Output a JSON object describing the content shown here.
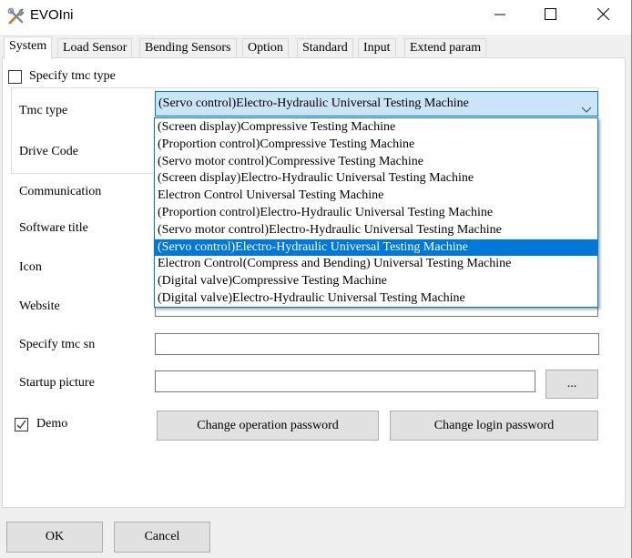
{
  "window": {
    "title": "EVOIni",
    "icon": "tools-icon",
    "controls": {
      "minimize": "minimize-icon",
      "maximize": "maximize-icon",
      "close": "close-icon"
    }
  },
  "tabs": [
    {
      "label": "System",
      "active": true
    },
    {
      "label": "Load Sensor",
      "active": false
    },
    {
      "label": "Bending Sensors",
      "active": false
    },
    {
      "label": "Option",
      "active": false
    },
    {
      "label": "Standard",
      "active": false
    },
    {
      "label": "Input",
      "active": false
    },
    {
      "label": "Extend param",
      "active": false
    }
  ],
  "system": {
    "specify_tmc_type": {
      "label": "Specify tmc type",
      "checked": false
    },
    "tmc_type": {
      "label": "Tmc type",
      "value": "(Servo control)Electro-Hydraulic Universal Testing Machine",
      "options": [
        "(Screen display)Compressive Testing Machine",
        "(Proportion control)Compressive Testing Machine",
        "(Servo motor control)Compressive Testing Machine",
        "(Screen display)Electro-Hydraulic Universal Testing Machine",
        "Electron Control Universal Testing Machine",
        "(Proportion control)Electro-Hydraulic Universal Testing Machine",
        "(Servo motor control)Electro-Hydraulic Universal Testing Machine",
        "(Servo control)Electro-Hydraulic Universal Testing Machine",
        "Electron Control(Compress and Bending) Universal Testing Machine",
        "(Digital valve)Compressive Testing Machine",
        "(Digital valve)Electro-Hydraulic Universal Testing Machine"
      ],
      "selected_index": 7,
      "dropdown_open": true
    },
    "drive_code": {
      "label": "Drive Code",
      "value": ""
    },
    "communication": {
      "label": "Communication",
      "value": ""
    },
    "software_title": {
      "label": "Software title",
      "value": ""
    },
    "icon": {
      "label": "Icon",
      "value": ""
    },
    "website": {
      "label": "Website",
      "value": ""
    },
    "specify_tmc_sn": {
      "label": "Specify tmc sn",
      "value": ""
    },
    "startup_picture": {
      "label": "Startup picture",
      "value": "",
      "browse_label": "..."
    },
    "demo": {
      "label": "Demo",
      "checked": true
    },
    "change_operation_password": "Change operation password",
    "change_login_password": "Change login password"
  },
  "footer": {
    "ok": "OK",
    "cancel": "Cancel"
  },
  "colors": {
    "accent": "#0078d7",
    "selection_bg": "#cce4f7",
    "button_bg": "#e1e1e1"
  }
}
